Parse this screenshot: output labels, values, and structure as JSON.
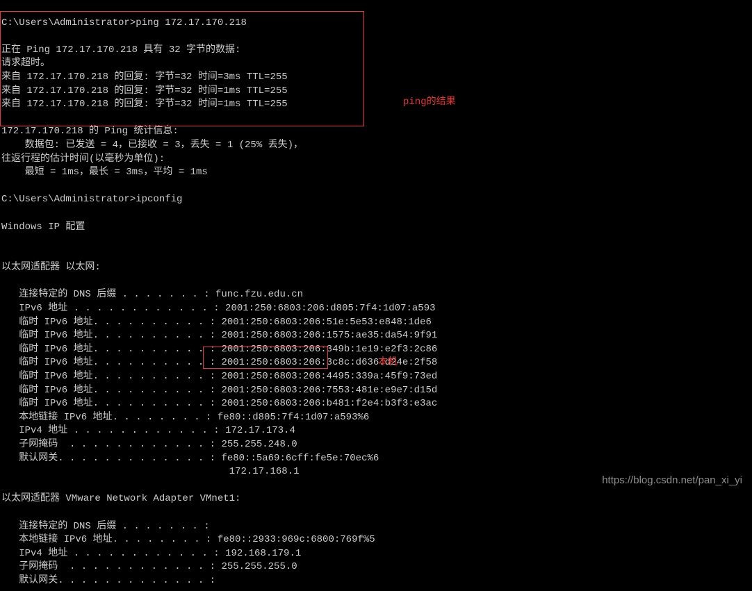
{
  "terminal": {
    "lines": [
      "",
      "C:\\Users\\Administrator>ping 172.17.170.218",
      "",
      "正在 Ping 172.17.170.218 具有 32 字节的数据:",
      "请求超时。",
      "来自 172.17.170.218 的回复: 字节=32 时间=3ms TTL=255",
      "来自 172.17.170.218 的回复: 字节=32 时间=1ms TTL=255",
      "来自 172.17.170.218 的回复: 字节=32 时间=1ms TTL=255",
      "",
      "172.17.170.218 的 Ping 统计信息:",
      "    数据包: 已发送 = 4，已接收 = 3，丢失 = 1 (25% 丢失)，",
      "往返行程的估计时间(以毫秒为单位):",
      "    最短 = 1ms，最长 = 3ms，平均 = 1ms",
      "",
      "C:\\Users\\Administrator>ipconfig",
      "",
      "Windows IP 配置",
      "",
      "",
      "以太网适配器 以太网:",
      "",
      "   连接特定的 DNS 后缀 . . . . . . . : func.fzu.edu.cn",
      "   IPv6 地址 . . . . . . . . . . . . : 2001:250:6803:206:d805:7f4:1d07:a593",
      "   临时 IPv6 地址. . . . . . . . . . : 2001:250:6803:206:51e:5e53:e848:1de6",
      "   临时 IPv6 地址. . . . . . . . . . : 2001:250:6803:206:1575:ae35:da54:9f91",
      "   临时 IPv6 地址. . . . . . . . . . : 2001:250:6803:206:349b:1e19:e2f3:2c86",
      "   临时 IPv6 地址. . . . . . . . . . : 2001:250:6803:206:3c8c:d636:d24e:2f58",
      "   临时 IPv6 地址. . . . . . . . . . : 2001:250:6803:206:4495:339a:45f9:73ed",
      "   临时 IPv6 地址. . . . . . . . . . : 2001:250:6803:206:7553:481e:e9e7:d15d",
      "   临时 IPv6 地址. . . . . . . . . . : 2001:250:6803:206:b481:f2e4:b3f3:e3ac",
      "   本地链接 IPv6 地址. . . . . . . . : fe80::d805:7f4:1d07:a593%6",
      "   IPv4 地址 . . . . . . . . . . . . : 172.17.173.4",
      "   子网掩码  . . . . . . . . . . . . : 255.255.248.0",
      "   默认网关. . . . . . . . . . . . . : fe80::5a69:6cff:fe5e:70ec%6",
      "                                       172.17.168.1",
      "",
      "以太网适配器 VMware Network Adapter VMnet1:",
      "",
      "   连接特定的 DNS 后缀 . . . . . . . :",
      "   本地链接 IPv6 地址. . . . . . . . : fe80::2933:969c:6800:769f%5",
      "   IPv4 地址 . . . . . . . . . . . . : 192.168.179.1",
      "   子网掩码  . . . . . . . . . . . . : 255.255.255.0",
      "   默认网关. . . . . . . . . . . . . :",
      ""
    ]
  },
  "annotations": {
    "ping_result": "ping的结果",
    "local_machine": "本机"
  },
  "watermark": "https://blog.csdn.net/pan_xi_yi"
}
